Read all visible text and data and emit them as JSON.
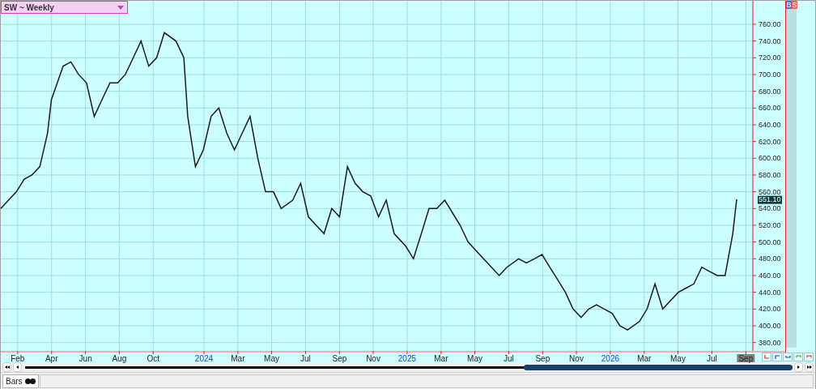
{
  "chart_window": {
    "title": "SW ~ Weekly",
    "buttons": [
      "B",
      "S"
    ]
  },
  "chart": {
    "last_price": "551.10",
    "chart_data": {
      "type": "line",
      "grid": true,
      "xlim": [
        2023,
        2026.861
      ],
      "ylim": [
        370,
        788
      ],
      "x": [
        2023,
        2023.038,
        2023.077,
        2023.115,
        2023.153,
        2023.192,
        2023.23,
        2023.249,
        2023.307,
        2023.345,
        2023.383,
        2023.422,
        2023.46,
        2023.498,
        2023.537,
        2023.575,
        2023.613,
        2023.652,
        2023.69,
        2023.728,
        2023.767,
        2023.805,
        2023.862,
        2023.901,
        2023.92,
        2023.958,
        2023.997,
        2024.035,
        2024.073,
        2024.112,
        2024.15,
        2024.188,
        2024.227,
        2024.265,
        2024.303,
        2024.342,
        2024.38,
        2024.437,
        2024.476,
        2024.514,
        2024.552,
        2024.591,
        2024.629,
        2024.667,
        2024.706,
        2024.744,
        2024.782,
        2024.821,
        2024.859,
        2024.897,
        2024.936,
        2024.993,
        2025.031,
        2025.07,
        2025.108,
        2025.146,
        2025.185,
        2025.223,
        2025.261,
        2025.3,
        2025.338,
        2025.376,
        2025.415,
        2025.453,
        2025.491,
        2025.549,
        2025.587,
        2025.626,
        2025.664,
        2025.702,
        2025.741,
        2025.779,
        2025.817,
        2025.856,
        2025.894,
        2025.932,
        2025.97,
        2026.009,
        2026.047,
        2026.085,
        2026.143,
        2026.181,
        2026.22,
        2026.258,
        2026.296,
        2026.335,
        2026.373,
        2026.411,
        2026.45,
        2026.488,
        2026.526,
        2026.565,
        2026.603,
        2026.622
      ],
      "series": [
        {
          "color": "#1a1a1a",
          "values": [
            540,
            550,
            560,
            575,
            580,
            590,
            630,
            670,
            710,
            715,
            700,
            690,
            650,
            670,
            690,
            690,
            700,
            720,
            740,
            710,
            720,
            750,
            740,
            720,
            650,
            590,
            610,
            650,
            660,
            630,
            610,
            630,
            650,
            600,
            560,
            560,
            540,
            550,
            570,
            530,
            520,
            510,
            540,
            530,
            590,
            570,
            560,
            555,
            530,
            550,
            510,
            495,
            480,
            510,
            540,
            540,
            550,
            535,
            520,
            500,
            490,
            480,
            470,
            460,
            470,
            480,
            475,
            480,
            485,
            470,
            455,
            440,
            420,
            410,
            420,
            425,
            420,
            415,
            400,
            395,
            405,
            420,
            450,
            420,
            430,
            440,
            445,
            450,
            470,
            465,
            460,
            460,
            510,
            551
          ]
        }
      ],
      "yticks": [
        {
          "value": 380,
          "label": "380.00"
        },
        {
          "value": 400,
          "label": "400.00"
        },
        {
          "value": 420,
          "label": "420.00"
        },
        {
          "value": 440,
          "label": "440.00"
        },
        {
          "value": 460,
          "label": "460.00"
        },
        {
          "value": 480,
          "label": "480.00"
        },
        {
          "value": 500,
          "label": "500.00"
        },
        {
          "value": 520,
          "label": "520.00"
        },
        {
          "value": 540,
          "label": "540.00"
        },
        {
          "value": 560,
          "label": "560.00"
        },
        {
          "value": 580,
          "label": "580.00"
        },
        {
          "value": 600,
          "label": "600.00"
        },
        {
          "value": 620,
          "label": "620.00"
        },
        {
          "value": 640,
          "label": "640.00"
        },
        {
          "value": 660,
          "label": "660.00"
        },
        {
          "value": 680,
          "label": "680.00"
        },
        {
          "value": 700,
          "label": "700.00"
        },
        {
          "value": 720,
          "label": "720.00"
        },
        {
          "value": 740,
          "label": "740.00"
        },
        {
          "value": 760,
          "label": "760.00"
        }
      ],
      "xticks": [
        {
          "value": 2023.083,
          "label": "Feb"
        },
        {
          "value": 2023.25,
          "label": "Apr"
        },
        {
          "value": 2023.417,
          "label": "Jun"
        },
        {
          "value": 2023.583,
          "label": "Aug"
        },
        {
          "value": 2023.75,
          "label": "Oct"
        },
        {
          "value": 2024,
          "label": "2024"
        },
        {
          "value": 2024.167,
          "label": "Mar"
        },
        {
          "value": 2024.333,
          "label": "May"
        },
        {
          "value": 2024.5,
          "label": "Jul"
        },
        {
          "value": 2024.667,
          "label": "Sep"
        },
        {
          "value": 2024.833,
          "label": "Nov"
        },
        {
          "value": 2025,
          "label": "2025"
        },
        {
          "value": 2025.167,
          "label": "Mar"
        },
        {
          "value": 2025.333,
          "label": "May"
        },
        {
          "value": 2025.5,
          "label": "Jul"
        },
        {
          "value": 2025.667,
          "label": "Sep"
        },
        {
          "value": 2025.833,
          "label": "Nov"
        },
        {
          "value": 2026,
          "label": "2026"
        },
        {
          "value": 2026.167,
          "label": "Mar"
        },
        {
          "value": 2026.333,
          "label": "May"
        },
        {
          "value": 2026.5,
          "label": "Jul"
        },
        {
          "value": 2026.667,
          "label": "Sep"
        }
      ]
    }
  },
  "status_bar": {
    "tab": "Bars"
  }
}
